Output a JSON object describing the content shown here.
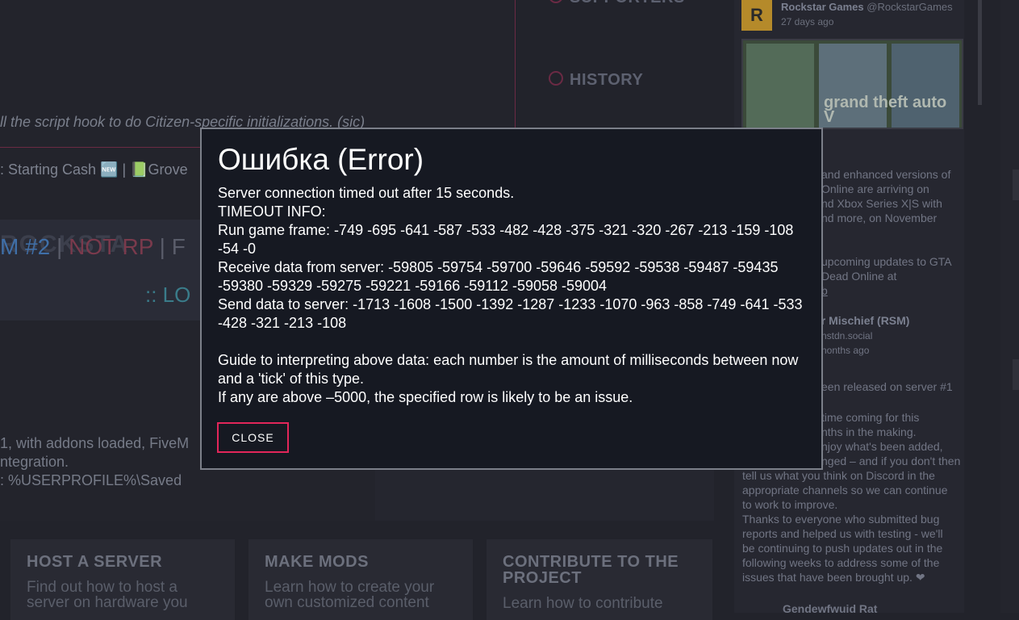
{
  "background": {
    "italic_line": "ll the script hook to do Citizen-specific initializations. (sic)",
    "cash_line": ": Starting Cash 🆕 | 📗Grove",
    "banner_big": "ROCKSTA",
    "banner_parts": [
      "M #2",
      " | ",
      "NOT RP",
      " | F"
    ],
    "banner_lo": ":: LO",
    "info_lines": [
      "1, with addons loaded, FiveM",
      "ntegration.",
      ": %USERPROFILE%\\Saved"
    ],
    "side_menu": [
      "SUPPORTERS",
      "HISTORY"
    ],
    "cards": [
      {
        "title": "HOST A SERVER",
        "desc": "Find out how to host a server on hardware you"
      },
      {
        "title": "MAKE MODS",
        "desc": "Learn how to create your own customized content"
      },
      {
        "title": "CONTRIBUTE TO THE PROJECT",
        "desc": "Learn how to contribute"
      }
    ]
  },
  "twitter": {
    "author": "Rockstar Games",
    "handle": "@RockstarGames",
    "time": "27 days ago",
    "image_logo": "grand theft auto V",
    "text_a": [
      "and enhanced versions of",
      "Online are arriving on",
      "nd Xbox Series X|S with",
      "nd more, on November"
    ],
    "text_b": [
      "upcoming updates to GTA",
      "Dead Online at",
      "b"
    ],
    "rsm_name": "ar Mischief (RSM)",
    "rsm_handle": "nstdn.social",
    "rsm_time": "nonths ago",
    "text_c": "een released on server #1",
    "text_d": [
      "time coming for this",
      "nths in the making.",
      "njoy what's been added,",
      "nged – and if you don't then"
    ],
    "text_e": [
      "tell us what you think on Discord in the",
      "appropriate channels so we can continue",
      "to work to improve.",
      "Thanks to everyone who submitted bug",
      "reports and helped us with testing - we'll",
      "be continuing to push updates out in the",
      "following weeks to address some of the",
      "issues that have been brought up. ❤"
    ],
    "text_f": "Gendewfwuid Rat"
  },
  "modal": {
    "title": "Ошибка (Error)",
    "lines": [
      "Server connection timed out after 15 seconds.",
      "TIMEOUT INFO:",
      "Run game frame: -749 -695 -641 -587 -533 -482 -428 -375 -321 -320 -267 -213 -159 -108 -54 -0",
      "Receive data from server: -59805 -59754 -59700 -59646 -59592 -59538 -59487 -59435 -59380 -59329 -59275 -59221 -59166 -59112 -59058 -59004",
      "Send data to server: -1713 -1608 -1500 -1392 -1287 -1233 -1070 -963 -858 -749 -641 -533 -428 -321 -213 -108"
    ],
    "guide_lines": [
      "Guide to interpreting above data: each number is the amount of milliseconds between now and a 'tick' of this type.",
      "If any are above –5000, the specified row is likely to be an issue."
    ],
    "close_label": "CLOSE"
  }
}
